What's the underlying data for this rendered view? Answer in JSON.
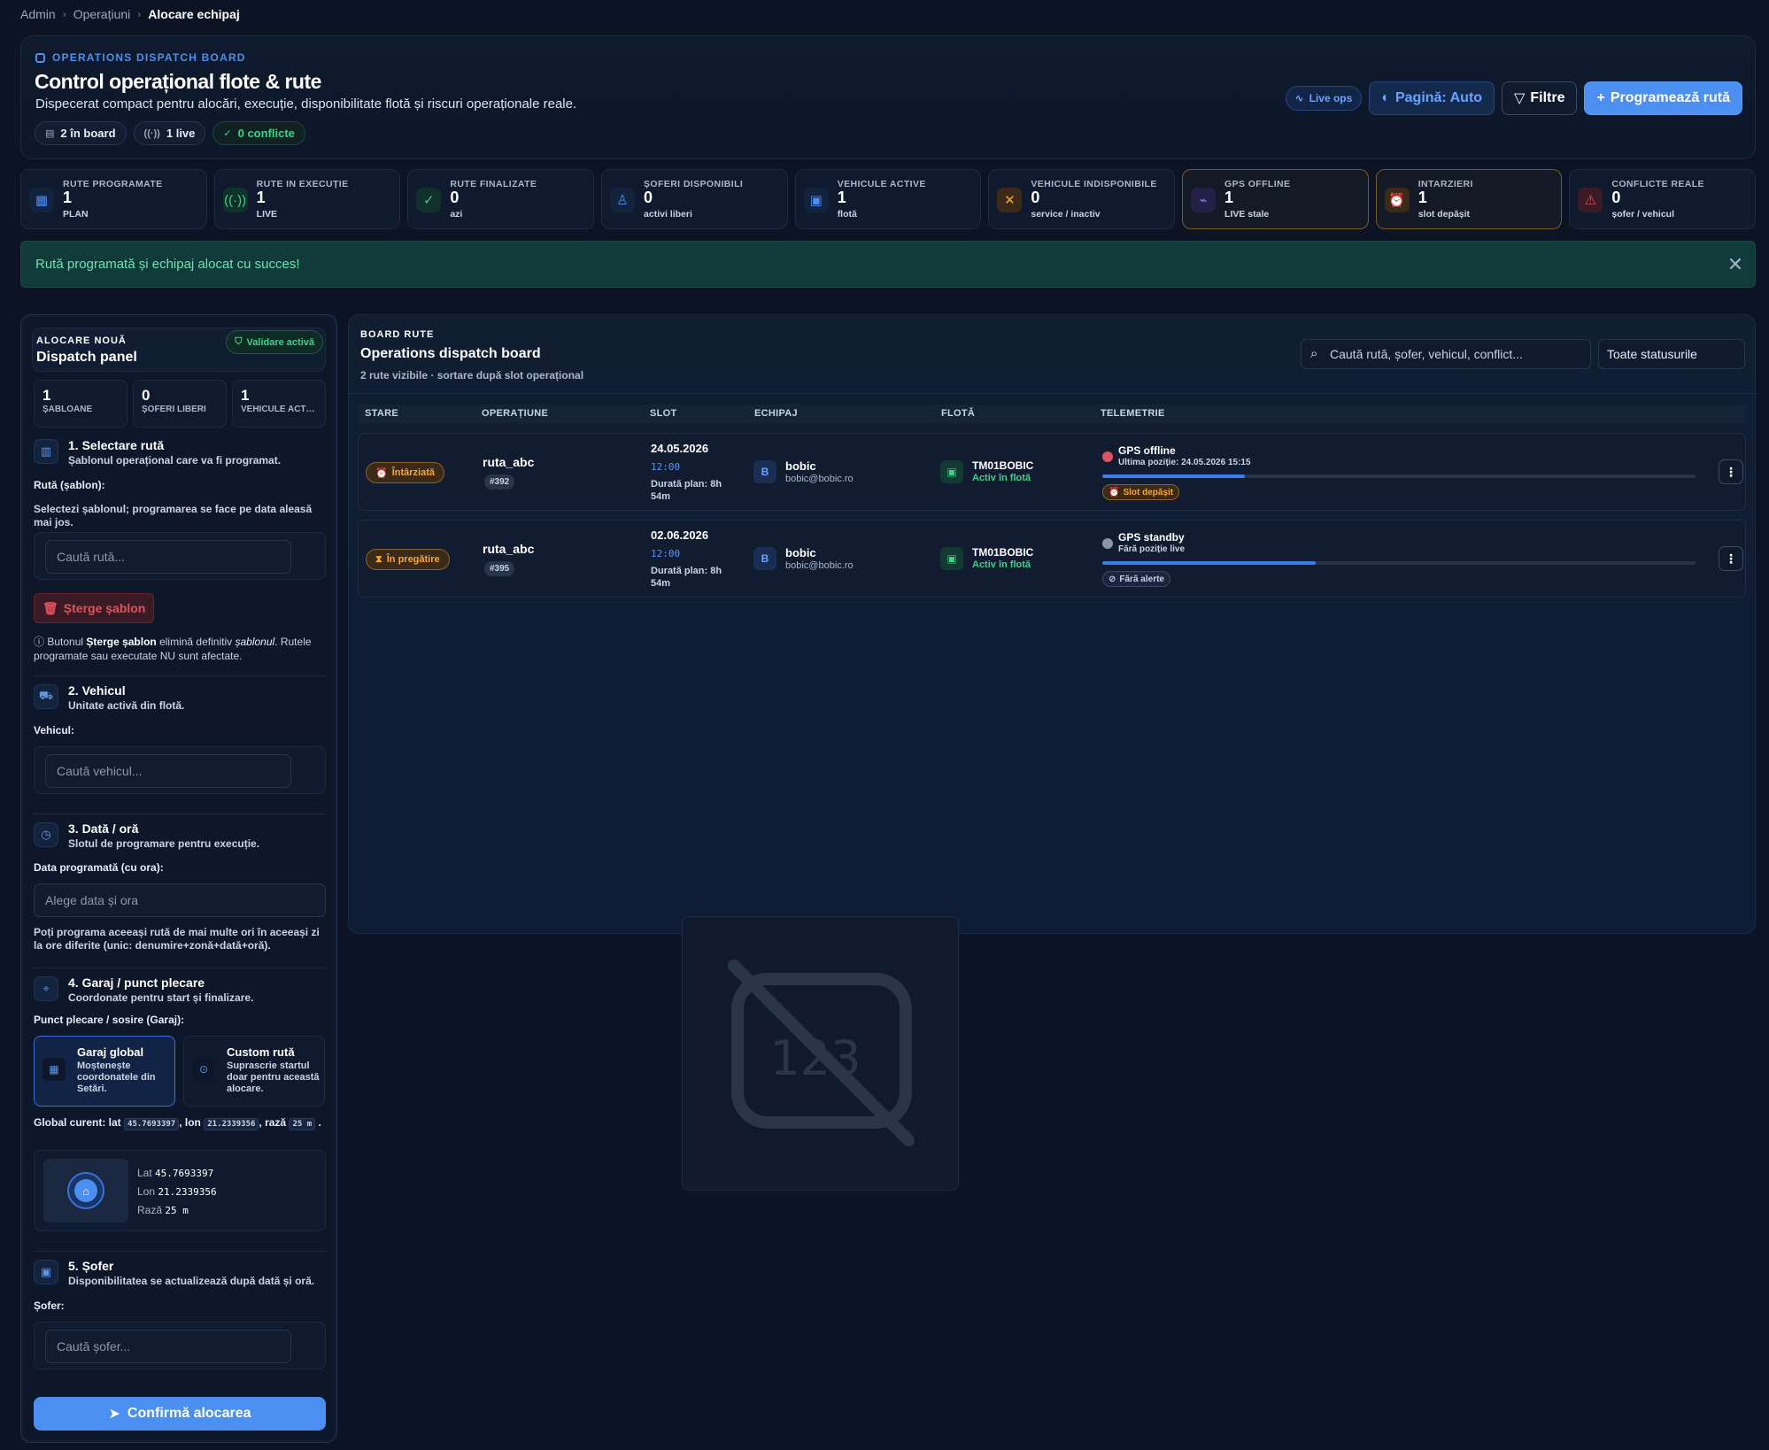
{
  "breadcrumb": [
    "Admin",
    "Operațiuni",
    "Alocare echipaj"
  ],
  "header": {
    "eyebrow": "OPERATIONS DISPATCH BOARD",
    "title": "Control operațional flote & rute",
    "subtitle": "Dispecerat compact pentru alocări, execuție, disponibilitate flotă și riscuri operaționale reale.",
    "chips": [
      "2 în board",
      "1 live",
      "0 conflicte"
    ],
    "actions": {
      "live_ops": "Live ops",
      "page": "Pagină: Auto",
      "filters": "Filtre",
      "schedule": "Programează rută"
    }
  },
  "stats": [
    {
      "label": "RUTE PROGRAMATE",
      "value": "1",
      "note": "PLAN",
      "icon": "calendar-icon",
      "color": "#4d8ff0"
    },
    {
      "label": "RUTE IN EXECUȚIE",
      "value": "1",
      "note": "LIVE",
      "icon": "broadcast-icon",
      "color": "#3fd08a"
    },
    {
      "label": "RUTE FINALIZATE",
      "value": "0",
      "note": "azi",
      "icon": "check-circle-icon",
      "color": "#3fd08a"
    },
    {
      "label": "ȘOFERI DISPONIBILI",
      "value": "0",
      "note": "activi liberi",
      "icon": "user-check-icon",
      "color": "#4d8ff0"
    },
    {
      "label": "VEHICULE ACTIVE",
      "value": "1",
      "note": "flotă",
      "icon": "bus-icon",
      "color": "#4d8ff0"
    },
    {
      "label": "VEHICULE INDISPONIBILE",
      "value": "0",
      "note": "service / inactiv",
      "icon": "wrench-icon",
      "color": "#f3a83b"
    },
    {
      "label": "GPS OFFLINE",
      "value": "1",
      "note": "LIVE stale",
      "icon": "satellite-off-icon",
      "color": "#8a7cf0"
    },
    {
      "label": "INTARZIERI",
      "value": "1",
      "note": "slot depășit",
      "icon": "alarm-icon",
      "color": "#f3a83b"
    },
    {
      "label": "CONFLICTE REALE",
      "value": "0",
      "note": "șofer / vehicul",
      "icon": "warning-icon",
      "color": "#e0525e"
    }
  ],
  "banner": {
    "message": "Rută programată și echipaj alocat cu succes!"
  },
  "left_panel": {
    "eyebrow": "ALOCARE NOUĂ",
    "title": "Dispatch panel",
    "badge": "Validare activă",
    "mini": [
      {
        "value": "1",
        "label": "ȘABLOANE"
      },
      {
        "value": "0",
        "label": "ȘOFERI LIBERI"
      },
      {
        "value": "1",
        "label": "VEHICULE ACTIVE"
      }
    ],
    "step1": {
      "title": "1. Selectare rută",
      "sub": "Șablonul operațional care va fi programat.",
      "label": "Rută (șablon):",
      "help": "Selectezi șablonul; programarea se face pe data aleasă mai jos.",
      "placeholder": "Caută rută...",
      "delete": "Șterge șablon",
      "note_a": "Butonul ",
      "note_b": "Șterge șablon",
      "note_c": " elimină definitiv ",
      "note_d": "șablonul",
      "note_e": ". Rutele programate sau executate NU sunt afectate."
    },
    "step2": {
      "title": "2. Vehicul",
      "sub": "Unitate activă din flotă.",
      "label": "Vehicul:",
      "placeholder": "Caută vehicul..."
    },
    "step3": {
      "title": "3. Dată / oră",
      "sub": "Slotul de programare pentru execuție.",
      "label": "Data programată (cu ora):",
      "placeholder": "Alege data și ora",
      "help": "Poți programa aceeași rută de mai multe ori în aceeași zi la ore diferite (unic: denumire+zonă+dată+oră)."
    },
    "step4": {
      "title": "4. Garaj / punct plecare",
      "sub": "Coordonate pentru start și finalizare.",
      "label": "Punct plecare / sosire (Garaj):",
      "global_title": "Garaj global",
      "global_desc": "Moștenește coordonatele din Setări.",
      "custom_title": "Custom rută",
      "custom_desc": "Suprascrie startul doar pentru această alocare.",
      "current_a": "Global curent: lat",
      "current_b": ", lon",
      "current_c": ", rază",
      "lat": "45.7693397",
      "lon": "21.2339356",
      "radius": "25 m",
      "lat_label": "Lat",
      "lon_label": "Lon",
      "radius_label": "Rază"
    },
    "step5": {
      "title": "5. Șofer",
      "sub": "Disponibilitatea se actualizează după dată și oră.",
      "label": "Șofer:",
      "placeholder": "Caută șofer..."
    },
    "confirm": "Confirmă alocarea"
  },
  "board": {
    "eyebrow": "BOARD RUTE",
    "title": "Operations dispatch board",
    "sub": "2 rute vizibile · sortare după slot operațional",
    "search_placeholder": "Caută rută, șofer, vehicul, conflict...",
    "status_select": "Toate statusurile",
    "columns": [
      "STARE",
      "OPERAȚIUNE",
      "SLOT",
      "ECHIPAJ",
      "FLOTĂ",
      "TELEMETRIE"
    ],
    "rows": [
      {
        "status": "Întârziată",
        "route": "ruta_abc",
        "id": "#392",
        "date": "24.05.2026",
        "time": "12:00",
        "duration": "Durată plan: 8h 54m",
        "avatar": "B",
        "crew": "bobic",
        "email": "bobic@bobic.ro",
        "plate": "TM01BOBIC",
        "fleet_state": "Activ în flotă",
        "gps_title": "GPS offline",
        "gps_sub": "Ultima poziție: 24.05.2026 15:15",
        "gps_color": "#e0525e",
        "progress": 0.24,
        "tag": "Slot depășit",
        "tag_type": "warn"
      },
      {
        "status": "În pregătire",
        "route": "ruta_abc",
        "id": "#395",
        "date": "02.06.2026",
        "time": "12:00",
        "duration": "Durată plan: 8h 54m",
        "avatar": "B",
        "crew": "bobic",
        "email": "bobic@bobic.ro",
        "plate": "TM01BOBIC",
        "fleet_state": "Activ în flotă",
        "gps_title": "GPS standby",
        "gps_sub": "Fără poziție live",
        "gps_color": "#8c96a8",
        "progress": 0.36,
        "tag": "Fără alerte",
        "tag_type": "ok"
      }
    ]
  }
}
